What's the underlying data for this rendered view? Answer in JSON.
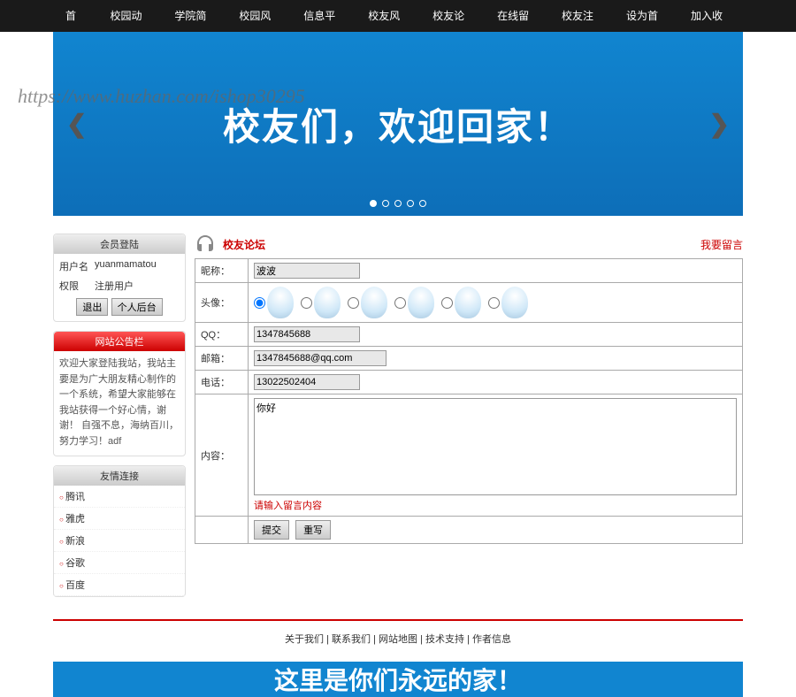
{
  "nav": {
    "items": [
      "首页",
      "校园动态",
      "学院简介",
      "校园风景",
      "信息平台",
      "校友风采",
      "校友论坛",
      "在线留言",
      "校友注册"
    ],
    "right": [
      "设为首页",
      "加入收藏"
    ]
  },
  "banner": {
    "text": "校友们，欢迎回家！",
    "watermark": "https://www.huzhan.com/ishop30295"
  },
  "login": {
    "title": "会员登陆",
    "username_label": "用户名",
    "username_value": "yuanmamatou",
    "role_label": "权限",
    "role_value": "注册用户",
    "btn_logout": "退出",
    "btn_profile": "个人后台"
  },
  "notice": {
    "title": "网站公告栏",
    "text": "欢迎大家登陆我站，我站主要是为广大朋友精心制作的一个系统，希望大家能够在我站获得一个好心情，谢谢！ 自强不息，海纳百川，努力学习！adf"
  },
  "links": {
    "title": "友情连接",
    "items": [
      "腾讯",
      "雅虎",
      "新浪",
      "谷歌",
      "百度"
    ]
  },
  "forum": {
    "title": "校友论坛",
    "action_link": "我要留言",
    "fields": {
      "nickname": {
        "label": "昵称：",
        "value": "波波"
      },
      "avatar": {
        "label": "头像："
      },
      "qq": {
        "label": "QQ：",
        "value": "1347845688"
      },
      "email": {
        "label": "邮箱：",
        "value": "1347845688@qq.com"
      },
      "phone": {
        "label": "电话：",
        "value": "13022502404"
      },
      "content": {
        "label": "内容：",
        "value": "你好"
      }
    },
    "error": "请输入留言内容",
    "btn_submit": "提交",
    "btn_reset": "重写"
  },
  "footer": {
    "items": [
      "关于我们",
      "联系我们",
      "网站地图",
      "技术支持",
      "作者信息"
    ]
  },
  "bottom_banner": "这里是你们永远的家！"
}
